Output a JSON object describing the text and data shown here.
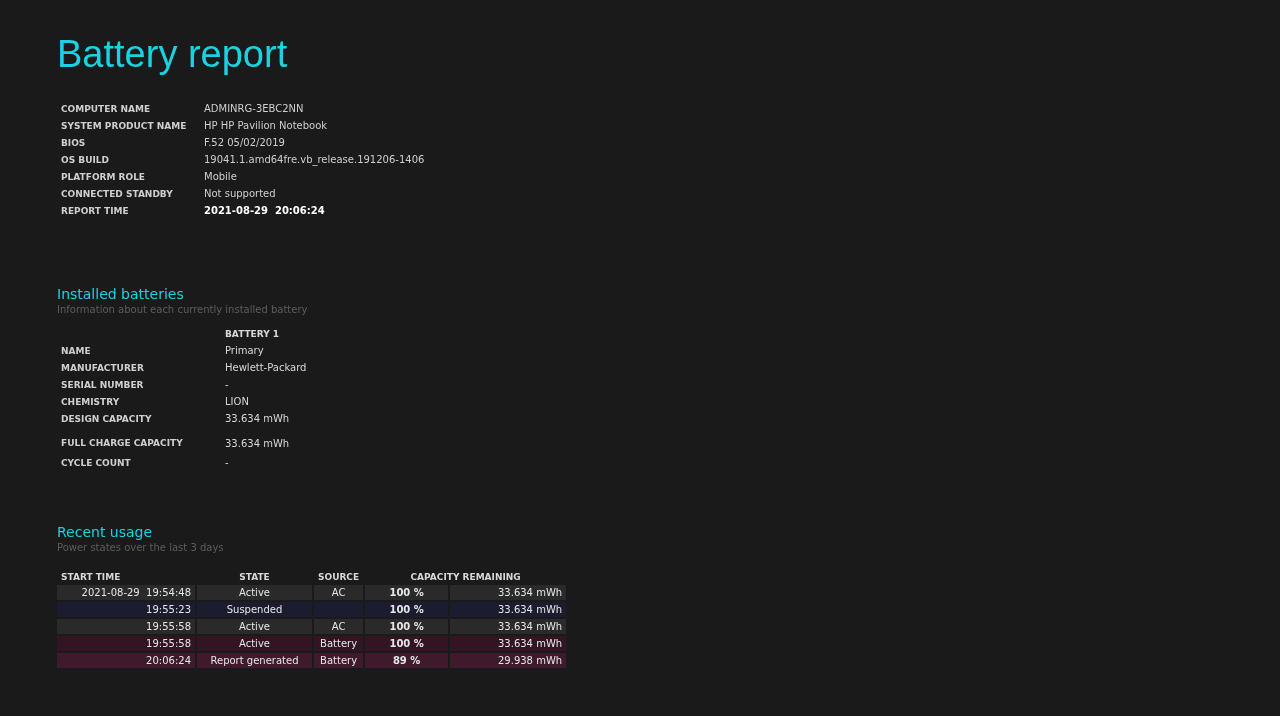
{
  "title": "Battery report",
  "system_info": [
    {
      "label": "COMPUTER NAME",
      "value": "ADMINRG-3EBC2NN",
      "emphasis": false
    },
    {
      "label": "SYSTEM PRODUCT NAME",
      "value": "HP HP Pavilion Notebook",
      "emphasis": false
    },
    {
      "label": "BIOS",
      "value": "F.52 05/02/2019",
      "emphasis": false
    },
    {
      "label": "OS BUILD",
      "value": "19041.1.amd64fre.vb_release.191206-1406",
      "emphasis": false
    },
    {
      "label": "PLATFORM ROLE",
      "value": "Mobile",
      "emphasis": false
    },
    {
      "label": "CONNECTED STANDBY",
      "value": "Not supported",
      "emphasis": false
    },
    {
      "label": "REPORT TIME",
      "value": "2021-08-29  20:06:24",
      "emphasis": true
    }
  ],
  "installed_batteries": {
    "heading": "Installed batteries",
    "subtitle": "Information about each currently installed battery",
    "column": "BATTERY 1",
    "rows": [
      {
        "label": "NAME",
        "value": "Primary"
      },
      {
        "label": "MANUFACTURER",
        "value": "Hewlett-Packard"
      },
      {
        "label": "SERIAL NUMBER",
        "value": "-"
      },
      {
        "label": "CHEMISTRY",
        "value": "LION"
      },
      {
        "label": "DESIGN CAPACITY",
        "value": "33.634 mWh"
      },
      {
        "label": "FULL CHARGE CAPACITY",
        "value": "33.634 mWh"
      },
      {
        "label": "CYCLE COUNT",
        "value": "-"
      }
    ]
  },
  "recent_usage": {
    "heading": "Recent usage",
    "subtitle": "Power states over the last 3 days",
    "columns": [
      "START TIME",
      "STATE",
      "SOURCE",
      "CAPACITY REMAINING"
    ],
    "rows": [
      {
        "kind": "ac",
        "start_time": "2021-08-29  19:54:48",
        "state": "Active",
        "source": "AC",
        "percent": "100 %",
        "capacity": "33.634 mWh"
      },
      {
        "kind": "suspended",
        "start_time": "19:55:23",
        "state": "Suspended",
        "source": "",
        "percent": "100 %",
        "capacity": "33.634 mWh"
      },
      {
        "kind": "ac",
        "start_time": "19:55:58",
        "state": "Active",
        "source": "AC",
        "percent": "100 %",
        "capacity": "33.634 mWh"
      },
      {
        "kind": "battery",
        "start_time": "19:55:58",
        "state": "Active",
        "source": "Battery",
        "percent": "100 %",
        "capacity": "33.634 mWh"
      },
      {
        "kind": "report",
        "start_time": "20:06:24",
        "state": "Report generated",
        "source": "Battery",
        "percent": "89 %",
        "capacity": "29.938 mWh"
      }
    ]
  }
}
